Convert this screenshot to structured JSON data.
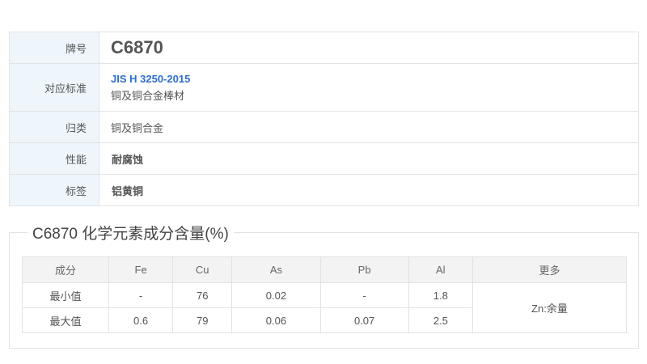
{
  "info": {
    "grade_label": "牌号",
    "grade": "C6870",
    "standard_label": "对应标准",
    "standard_link": "JIS H 3250-2015",
    "standard_desc": "铜及铜合金棒材",
    "category_label": "归类",
    "category": "铜及铜合金",
    "property_label": "性能",
    "property": "耐腐蚀",
    "tag_label": "标签",
    "tag": "铝黄铜"
  },
  "composition": {
    "title": "C6870 化学元素成分含量(%)",
    "headers": [
      "成分",
      "Fe",
      "Cu",
      "As",
      "Pb",
      "Al",
      "更多"
    ],
    "rows": [
      {
        "label": "最小值",
        "values": [
          "-",
          "76",
          "0.02",
          "-",
          "1.8"
        ]
      },
      {
        "label": "最大值",
        "values": [
          "0.6",
          "79",
          "0.06",
          "0.07",
          "2.5"
        ]
      }
    ],
    "more": "Zn:余量"
  }
}
